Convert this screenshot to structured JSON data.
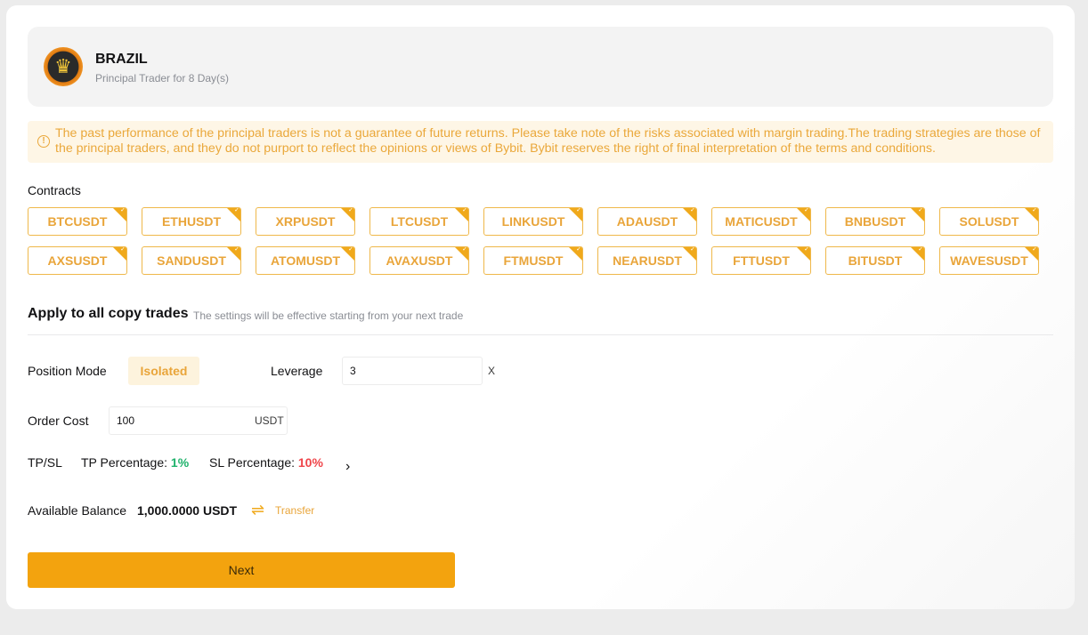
{
  "trader": {
    "name": "BRAZIL",
    "subtitle": "Principal Trader for 8 Day(s)",
    "avatar_icon": "crown-icon"
  },
  "notice": {
    "icon": "info-circle-icon",
    "text": "The past performance of the principal traders is not a guarantee of future returns. Please take note of the risks associated with margin trading.The trading strategies are those of the principal traders, and they do not purport to reflect the opinions or views of Bybit. Bybit reserves the right of final interpretation of the terms and conditions."
  },
  "contracts": {
    "label": "Contracts",
    "items": [
      {
        "label": "BTCUSDT",
        "selected": true
      },
      {
        "label": "ETHUSDT",
        "selected": true
      },
      {
        "label": "XRPUSDT",
        "selected": true
      },
      {
        "label": "LTCUSDT",
        "selected": true
      },
      {
        "label": "LINKUSDT",
        "selected": true
      },
      {
        "label": "ADAUSDT",
        "selected": true
      },
      {
        "label": "MATICUSDT",
        "selected": true
      },
      {
        "label": "BNBUSDT",
        "selected": true
      },
      {
        "label": "SOLUSDT",
        "selected": true
      },
      {
        "label": "AXSUSDT",
        "selected": true
      },
      {
        "label": "SANDUSDT",
        "selected": true
      },
      {
        "label": "ATOMUSDT",
        "selected": true
      },
      {
        "label": "AVAXUSDT",
        "selected": true
      },
      {
        "label": "FTMUSDT",
        "selected": true
      },
      {
        "label": "NEARUSDT",
        "selected": true
      },
      {
        "label": "FTTUSDT",
        "selected": true
      },
      {
        "label": "BITUSDT",
        "selected": true
      },
      {
        "label": "WAVESUSDT",
        "selected": true
      }
    ]
  },
  "settings": {
    "title": "Apply to all copy trades",
    "subtitle": "The settings will be effective starting from your next trade",
    "position_mode_label": "Position Mode",
    "position_mode_value": "Isolated",
    "leverage_label": "Leverage",
    "leverage_value": "3",
    "leverage_suffix": "X",
    "order_cost_label": "Order Cost",
    "order_cost_value": "100",
    "order_cost_suffix": "USDT",
    "tpsl_label": "TP/SL",
    "tp_label": "TP Percentage:",
    "tp_value": "1%",
    "sl_label": "SL Percentage:",
    "sl_value": "10%",
    "available_balance_label": "Available Balance",
    "available_balance_value": "1,000.0000 USDT",
    "transfer_label": "Transfer"
  },
  "actions": {
    "next_label": "Next"
  },
  "colors": {
    "accent": "#f3a30e",
    "chip_text": "#e9a53a",
    "tp_green": "#20b26c",
    "sl_red": "#ef454a",
    "notice_bg": "#fef6e6"
  }
}
